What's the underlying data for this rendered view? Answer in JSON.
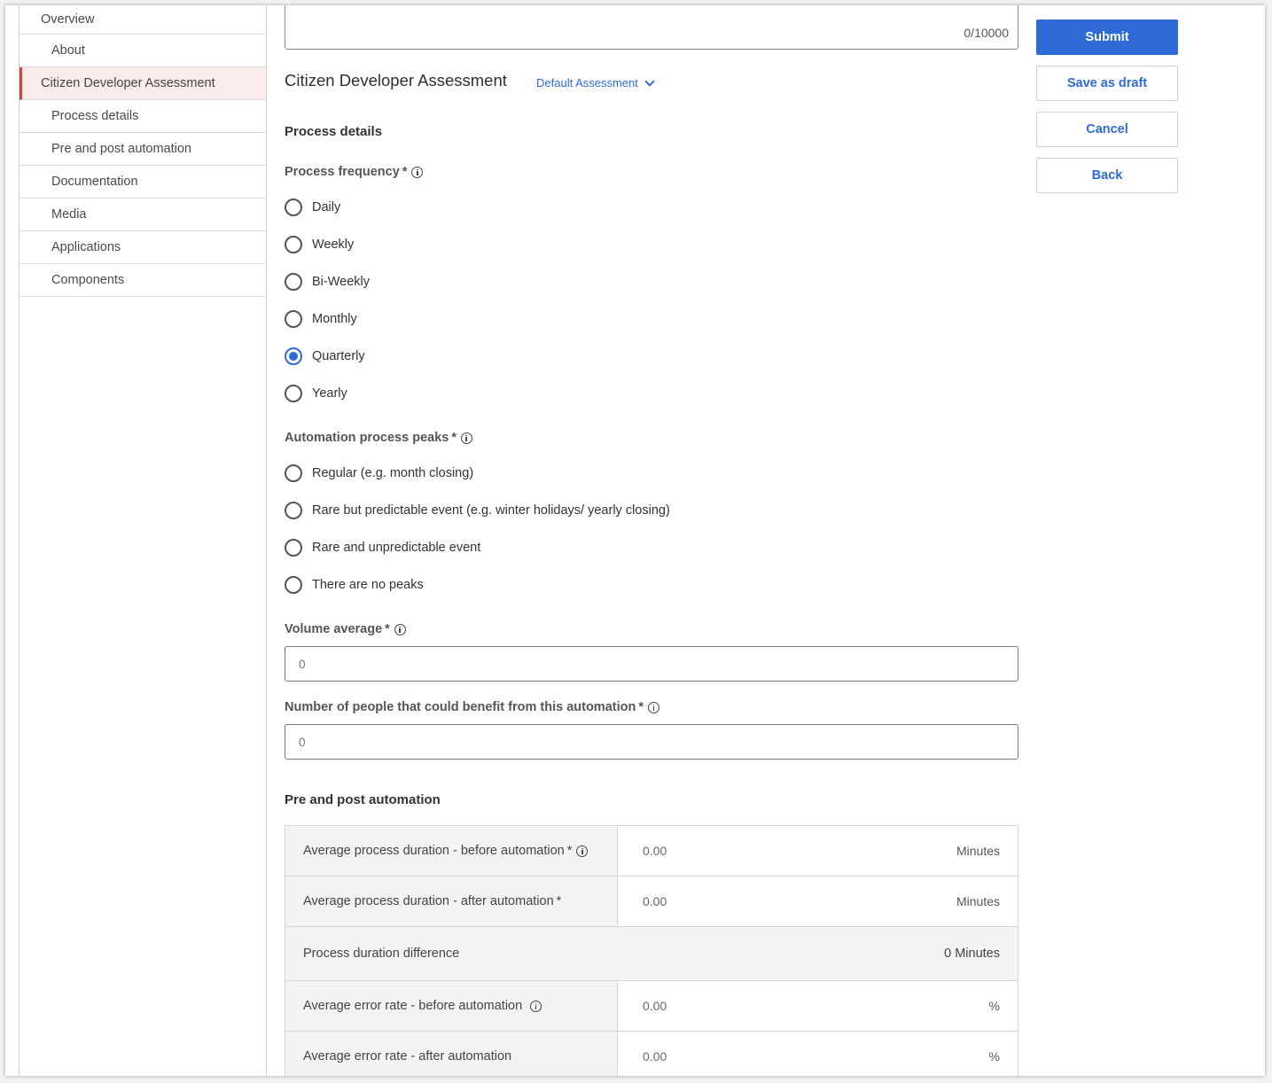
{
  "sidebar": {
    "items": [
      {
        "label": "Overview"
      },
      {
        "label": "About"
      },
      {
        "label": "Citizen Developer Assessment"
      },
      {
        "label": "Process details"
      },
      {
        "label": "Pre and post automation"
      },
      {
        "label": "Documentation"
      },
      {
        "label": "Media"
      },
      {
        "label": "Applications"
      },
      {
        "label": "Components"
      }
    ],
    "active_index": 2,
    "accent_color": "#c64a3c"
  },
  "description": {
    "char_count": "0/10000"
  },
  "assessment": {
    "title": "Citizen Developer Assessment",
    "selected": "Default Assessment"
  },
  "process_details": {
    "heading": "Process details",
    "frequency": {
      "label": "Process frequency",
      "required": "*",
      "options": [
        "Daily",
        "Weekly",
        "Bi-Weekly",
        "Monthly",
        "Quarterly",
        "Yearly"
      ],
      "selected": "Quarterly"
    },
    "peaks": {
      "label": "Automation process peaks",
      "required": "*",
      "options": [
        "Regular (e.g. month closing)",
        "Rare but predictable event (e.g. winter holidays/ yearly closing)",
        "Rare and unpredictable event",
        "There are no peaks"
      ]
    },
    "volume": {
      "label": "Volume average",
      "required": "*",
      "value": "0"
    },
    "people": {
      "label": "Number of people that could benefit from this automation",
      "required": "*",
      "value": "0"
    }
  },
  "pre_post": {
    "heading": "Pre and post automation",
    "rows": [
      {
        "label": "Average process duration - before automation",
        "required": "*",
        "value": "0.00",
        "unit": "Minutes"
      },
      {
        "label": "Average process duration - after automation",
        "required": "*",
        "value": "0.00",
        "unit": "Minutes"
      },
      {
        "label": "Process duration difference",
        "value": "0 Minutes"
      },
      {
        "label": "Average error rate - before automation",
        "value": "0.00",
        "unit": "%"
      },
      {
        "label": "Average error rate - after automation",
        "value": "0.00",
        "unit": "%"
      }
    ]
  },
  "actions": {
    "submit": "Submit",
    "save_draft": "Save as draft",
    "cancel": "Cancel",
    "back": "Back"
  },
  "colors": {
    "primary": "#2e6bd9"
  }
}
